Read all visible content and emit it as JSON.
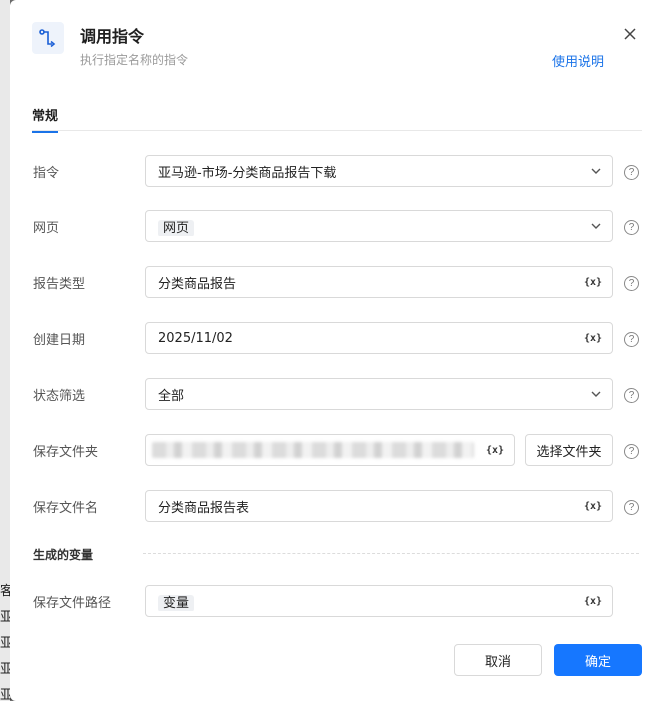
{
  "dialog": {
    "title": "调用指令",
    "subtitle": "执行指定名称的指令",
    "help_link": "使用说明",
    "icon": "flow-route-icon",
    "close_icon": "close-icon"
  },
  "tabs": [
    {
      "label": "常规",
      "active": true
    }
  ],
  "fields": {
    "command": {
      "label": "指令",
      "value": "亚马逊-市场-分类商品报告下载",
      "kind": "select"
    },
    "webpage": {
      "label": "网页",
      "value": "网页",
      "kind": "select-chip"
    },
    "report_type": {
      "label": "报告类型",
      "value": "分类商品报告",
      "kind": "variable-input"
    },
    "created_date": {
      "label": "创建日期",
      "value": "2025/11/02",
      "kind": "variable-input"
    },
    "status_filter": {
      "label": "状态筛选",
      "value": "全部",
      "kind": "select"
    },
    "save_folder": {
      "label": "保存文件夹",
      "kind": "variable-input-redacted"
    },
    "file_name": {
      "label": "保存文件名",
      "value": "分类商品报告表",
      "kind": "variable-input"
    }
  },
  "choose_folder_button": "选择文件夹",
  "variable_marker": "{x}",
  "help_marker": "?",
  "generated_section": {
    "label": "生成的变量",
    "path_field": {
      "label": "保存文件路径",
      "value": "变量"
    }
  },
  "footer": {
    "cancel": "取消",
    "ok": "确定"
  },
  "backdrop_glyphs": [
    "客",
    "亚",
    "亚",
    "亚",
    "亚"
  ],
  "colors": {
    "accent": "#1677ff",
    "link": "#1a73e8"
  }
}
